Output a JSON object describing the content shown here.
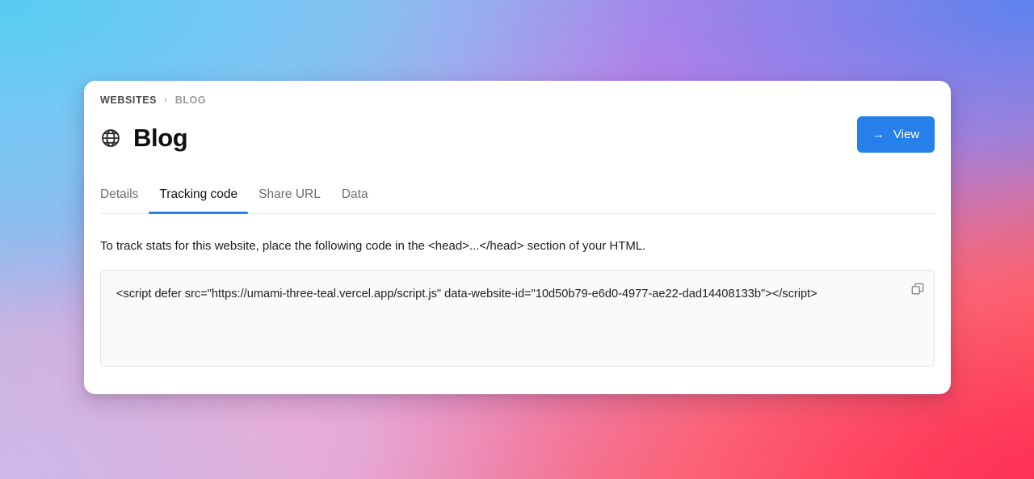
{
  "breadcrumb": {
    "root": "WEBSITES",
    "separator": "›",
    "current": "BLOG"
  },
  "header": {
    "icon": "globe-icon",
    "title": "Blog",
    "view_button": {
      "label": "View",
      "icon": "arrow-right-icon",
      "arrow": "→",
      "color": "#2680eb"
    }
  },
  "tabs": [
    {
      "label": "Details",
      "active": false
    },
    {
      "label": "Tracking code",
      "active": true
    },
    {
      "label": "Share URL",
      "active": false
    },
    {
      "label": "Data",
      "active": false
    }
  ],
  "content": {
    "instruction": "To track stats for this website, place the following code in the <head>...</head> section of your HTML.",
    "code": "<script defer src=\"https://umami-three-teal.vercel.app/script.js\" data-website-id=\"10d50b79-e6d0-4977-ae22-dad14408133b\"></script>",
    "copy_icon": "copy-icon"
  },
  "theme": {
    "accent": "#2680eb",
    "card_background": "#ffffff",
    "code_background": "#fafafa",
    "code_border": "#e6e6e6",
    "muted_text": "#6f6f6f"
  }
}
